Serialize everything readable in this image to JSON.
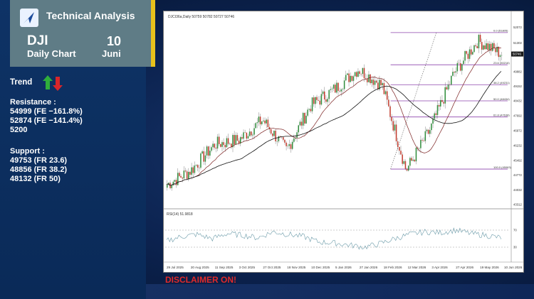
{
  "header": {
    "title": "Technical Analysis",
    "ticker": "DJI",
    "chart_kind": "Daily Chart",
    "day": "10",
    "month": "Juni"
  },
  "trend": {
    "label": "Trend",
    "up_icon": "green-up-arrow-icon",
    "down_icon": "red-down-arrow-icon"
  },
  "resistance": {
    "label": "Resistance :",
    "levels": [
      "54999 (FE −161.8%)",
      "52874 (FE −141.4%)",
      "5200"
    ]
  },
  "support": {
    "label": "Support :",
    "levels": [
      "49753 (FR 23.6)",
      "48856 (FR 38.2)",
      "48132 (FR 50)"
    ]
  },
  "disclaimer": "DISCLAIMER ON!",
  "colors": {
    "header_bg": "#5f7c86",
    "accent": "#e8c21c",
    "disclaimer": "#e02a2a",
    "up_candle": "#2e8b3a",
    "down_candle": "#c0392b",
    "fib_line": "#8e44ad"
  },
  "chart_data": {
    "type": "line",
    "title": "DJCI36a,Daily 50759 50782 50727 50746",
    "price_axis_ticks": [
      "52072",
      "51302",
      "50746",
      "49882",
      "49152",
      "48432",
      "47692",
      "46972",
      "46232",
      "45492",
      "44772",
      "44032",
      "43312"
    ],
    "last_price_label": "50746",
    "ylim": [
      43312,
      52572
    ],
    "x_ticks": [
      "29 Jul 2025",
      "20 Aug 2025",
      "11 Sep 2025",
      "3 Oct 2025",
      "27 Oct 2025",
      "18 Nov 2025",
      "10 Dec 2025",
      "5 Jan 2026",
      "27 Jan 2026",
      "18 Feb 2026",
      "12 Mar 2026",
      "3 Apr 2026",
      "27 Apr 2026",
      "19 May 2026",
      "10 Jun 2026"
    ],
    "series": [
      {
        "x": [
          "29 Jul 2025",
          "20 Aug 2025",
          "11 Sep 2025",
          "3 Oct 2025",
          "27 Oct 2025",
          "18 Nov 2025",
          "10 Dec 2025",
          "5 Jan 2026",
          "27 Jan 2026",
          "18 Feb 2026",
          "12 Mar 2026",
          "3 Apr 2026",
          "27 Apr 2026",
          "19 May 2026",
          "10 Jun 2026"
        ],
        "values": [
          44300,
          45000,
          46300,
          46500,
          47500,
          46000,
          48200,
          49000,
          50000,
          49200,
          45000,
          47000,
          49800,
          51400,
          50746
        ]
      }
    ],
    "fibonacci": [
      {
        "label": "0.0 (51805)",
        "value": 51805
      },
      {
        "label": "23.6 (50216)",
        "value": 50216
      },
      {
        "label": "38.2 (49231)",
        "value": 49231
      },
      {
        "label": "50.0 (48434)",
        "value": 48434
      },
      {
        "label": "61.8 (47638)",
        "value": 47638
      },
      {
        "label": "100.0 (45063)",
        "value": 45063
      }
    ],
    "rsi": {
      "label": "RSI(14) 51.9818",
      "levels": [
        "70",
        "30"
      ],
      "ylim": [
        0,
        100
      ],
      "values": [
        45,
        55,
        60,
        50,
        62,
        58,
        52,
        66,
        60,
        55,
        42,
        40,
        35,
        30,
        38,
        50,
        60,
        66,
        64,
        70,
        62,
        58,
        52
      ]
    }
  }
}
